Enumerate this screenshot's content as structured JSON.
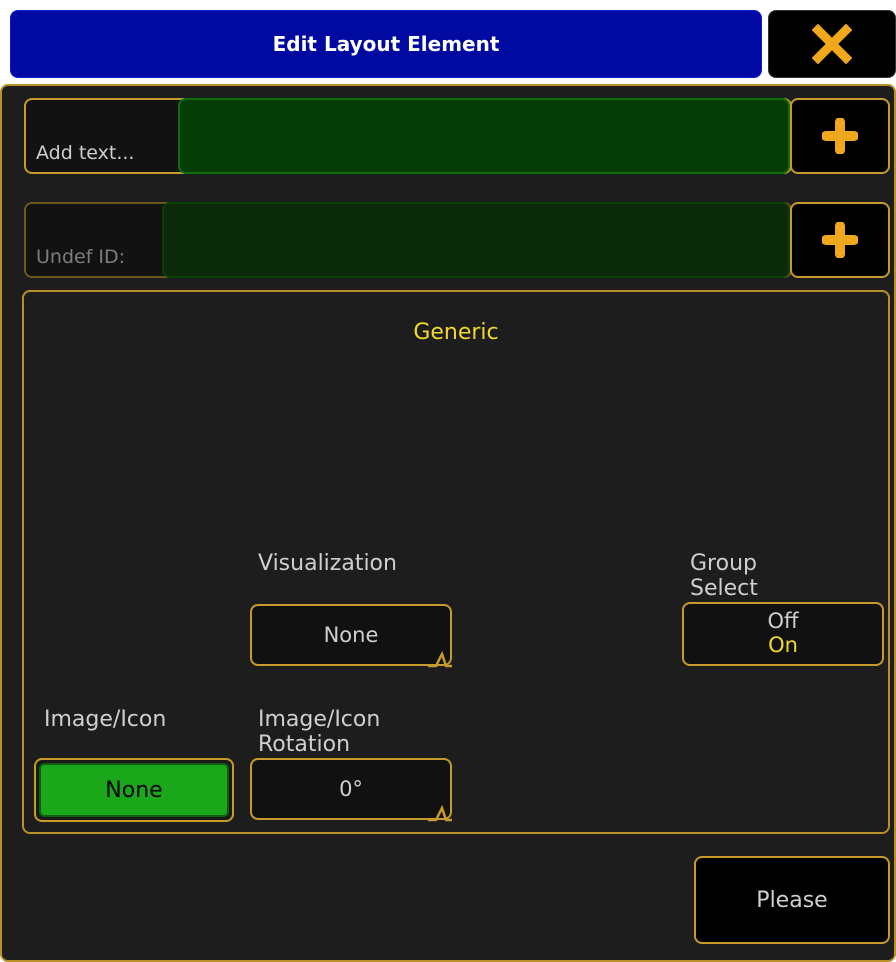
{
  "window": {
    "title": "Edit Layout Element",
    "close_icon": "close-x-icon"
  },
  "colors": {
    "title_bar": "#000aa0",
    "accent_border": "#c79a2c",
    "active_green": "#1aa81a",
    "highlight_text": "#f2d92b",
    "dialog_bg": "#1d1d1d"
  },
  "text_row": {
    "label": "Add text...",
    "value": "",
    "add_icon": "plus-icon"
  },
  "id_row": {
    "label": "Undef ID:",
    "value": "",
    "add_icon": "plus-icon"
  },
  "panel": {
    "title": "Generic",
    "visualization": {
      "label": "Visualization",
      "value": "None"
    },
    "group_select": {
      "label_line1": "Group",
      "label_line2": "Select",
      "option_off": "Off",
      "option_on": "On",
      "selected": "On"
    },
    "image_icon": {
      "label": "Image/Icon",
      "value": "None"
    },
    "image_icon_rotation": {
      "label_line1": "Image/Icon",
      "label_line2": "Rotation",
      "value": "0°"
    }
  },
  "footer": {
    "please_label": "Please"
  }
}
